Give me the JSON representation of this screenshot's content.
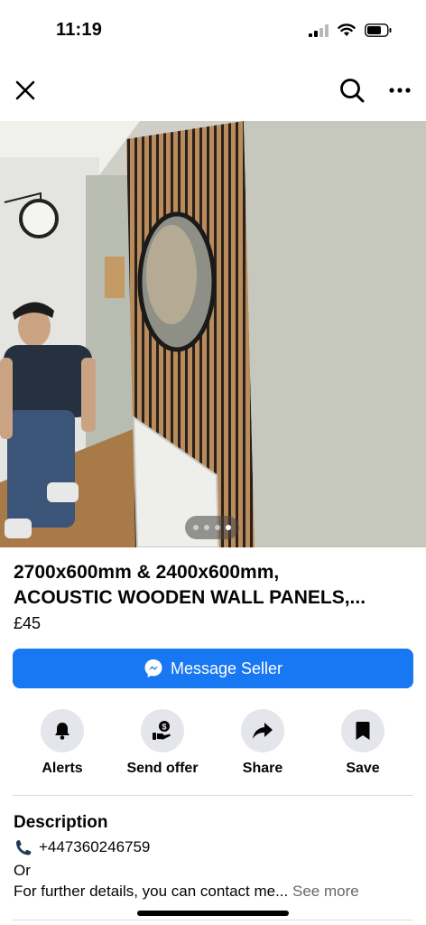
{
  "status_bar": {
    "time": "11:19"
  },
  "listing": {
    "title_line1": "2700x600mm & 2400x600mm,",
    "title_line2": "ACOUSTIC WOODEN WALL PANELS,...",
    "price": "£45",
    "photo_index": 4,
    "photo_count": 4
  },
  "message_button": {
    "label": "Message Seller"
  },
  "actions": [
    {
      "label": "Alerts",
      "icon": "bell-icon"
    },
    {
      "label": "Send offer",
      "icon": "offer-icon"
    },
    {
      "label": "Share",
      "icon": "share-icon"
    },
    {
      "label": "Save",
      "icon": "bookmark-icon"
    }
  ],
  "description": {
    "heading": "Description",
    "phone": "+447360246759",
    "or_text": "Or",
    "text": "For further details, you can contact me...",
    "see_more": "See more"
  },
  "colors": {
    "accent": "#1877f2",
    "icon_bg": "#e4e6eb",
    "muted": "#65676b"
  }
}
